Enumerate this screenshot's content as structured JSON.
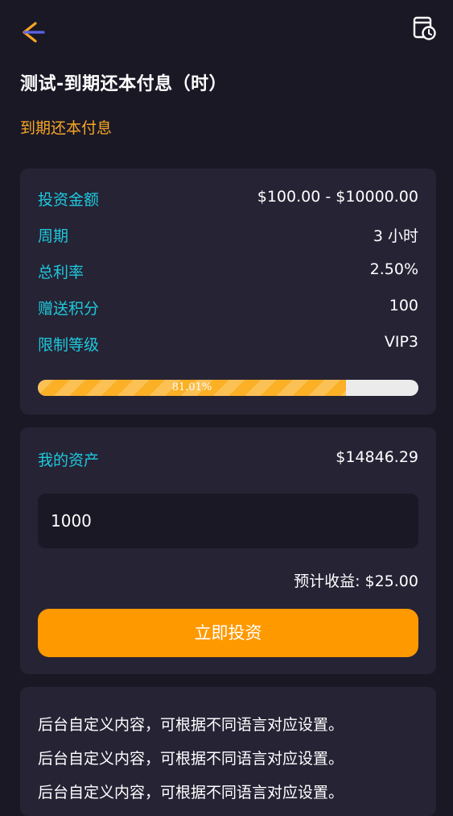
{
  "header": {
    "back_icon": "arrow-left-icon",
    "history_icon": "history-icon",
    "title": "测试-到期还本付息（时）",
    "subtitle": "到期还本付息"
  },
  "details": {
    "rows": [
      {
        "label": "投资金额",
        "value": "$100.00 - $10000.00"
      },
      {
        "label": "周期",
        "value": "3 小时"
      },
      {
        "label": "总利率",
        "value": "2.50%"
      },
      {
        "label": "赠送积分",
        "value": "100"
      },
      {
        "label": "限制等级",
        "value": "VIP3"
      }
    ],
    "progress_percent": 81.01,
    "progress_label": "81.01%"
  },
  "invest": {
    "asset_label": "我的资产",
    "asset_value": "$14846.29",
    "amount_value": "1000",
    "expected_return": "预计收益: $25.00",
    "button_label": "立即投资"
  },
  "notes": [
    "后台自定义内容，可根据不同语言对应设置。",
    "后台自定义内容，可根据不同语言对应设置。",
    "后台自定义内容，可根据不同语言对应设置。"
  ],
  "colors": {
    "background": "#1b1826",
    "card": "#262335",
    "label_cyan": "#1ec8dc",
    "accent_orange": "#ff9900",
    "subtitle_orange": "#f5a623",
    "progress_fill": "#fbb025"
  }
}
